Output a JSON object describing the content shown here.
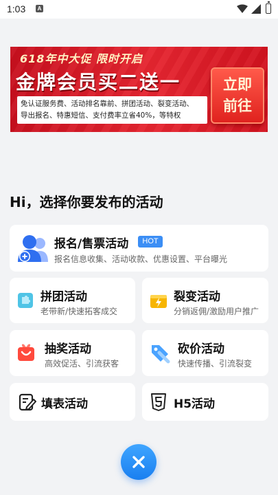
{
  "status_bar": {
    "time": "1:03",
    "notif_letter": "A"
  },
  "banner": {
    "top_text": "618年中大促  限时开启",
    "main_text": "金牌会员买二送一",
    "desc_line1": "免认证服务费、活动排名靠前、拼团活动、裂变活动、",
    "desc_line2": "导出报名、特惠短信、支付费率立省40%，等特权",
    "cta_line1": "立即",
    "cta_line2": "前往"
  },
  "section_title": "Hi，选择你要发布的活动",
  "activities": {
    "signup": {
      "title": "报名/售票活动",
      "badge": "HOT",
      "subtitle": "报名信息收集、活动收款、优惠设置、平台曝光"
    },
    "group": {
      "title": "拼团活动",
      "subtitle": "老带新/快速拓客成交"
    },
    "fission": {
      "title": "裂变活动",
      "subtitle": "分销返佣/激励用户推广"
    },
    "lottery": {
      "title": "抽奖活动",
      "subtitle": "高效促活、引流获客"
    },
    "bargain": {
      "title": "砍价活动",
      "subtitle": "快速传播、引流裂变"
    },
    "form": {
      "title": "填表活动"
    },
    "h5": {
      "title": "H5活动"
    }
  },
  "colors": {
    "accent_blue": "#1a7ff0",
    "banner_red": "#e62530",
    "card_bg": "#ffffff",
    "page_bg": "#f2f3f5"
  },
  "icons": [
    "user-plus-icon",
    "puzzle-icon",
    "lightning-card-icon",
    "gift-box-icon",
    "price-tag-icon",
    "edit-form-icon",
    "html5-icon",
    "close-icon"
  ]
}
